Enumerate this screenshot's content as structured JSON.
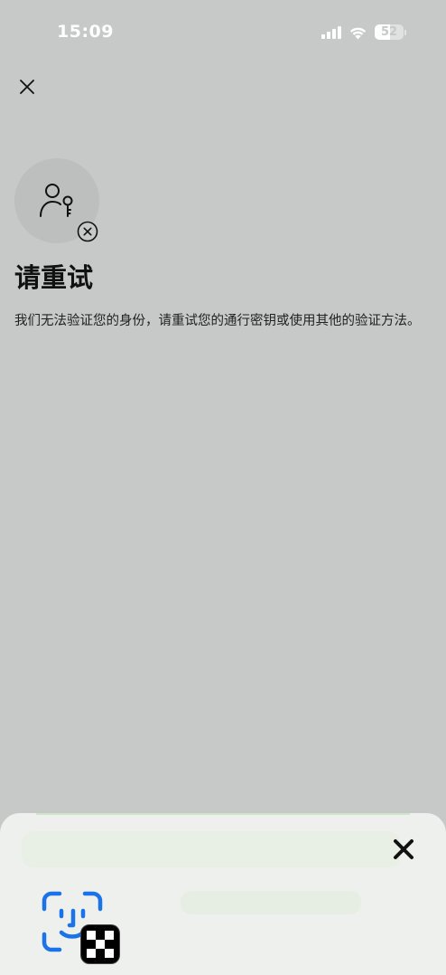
{
  "status_bar": {
    "time": "15:09",
    "battery_percent": "52",
    "battery_level": 0.52,
    "icons": [
      "cellular-signal-icon",
      "wifi-icon",
      "battery-icon"
    ]
  },
  "dialog": {
    "title": "请重试",
    "message": "我们无法验证您的身份，请重试您的通行密钥或使用其他的验证方法。",
    "icons": [
      "close-icon",
      "user-key-icon",
      "error-x-circle-icon"
    ]
  },
  "bottom_sheet": {
    "icons": [
      "close-icon",
      "face-id-icon",
      "okx-app-icon"
    ]
  },
  "colors": {
    "background": "#c7c8c8",
    "sheet_background": "#edf0ec",
    "face_id_blue": "#1a73e8",
    "text": "#111111"
  }
}
